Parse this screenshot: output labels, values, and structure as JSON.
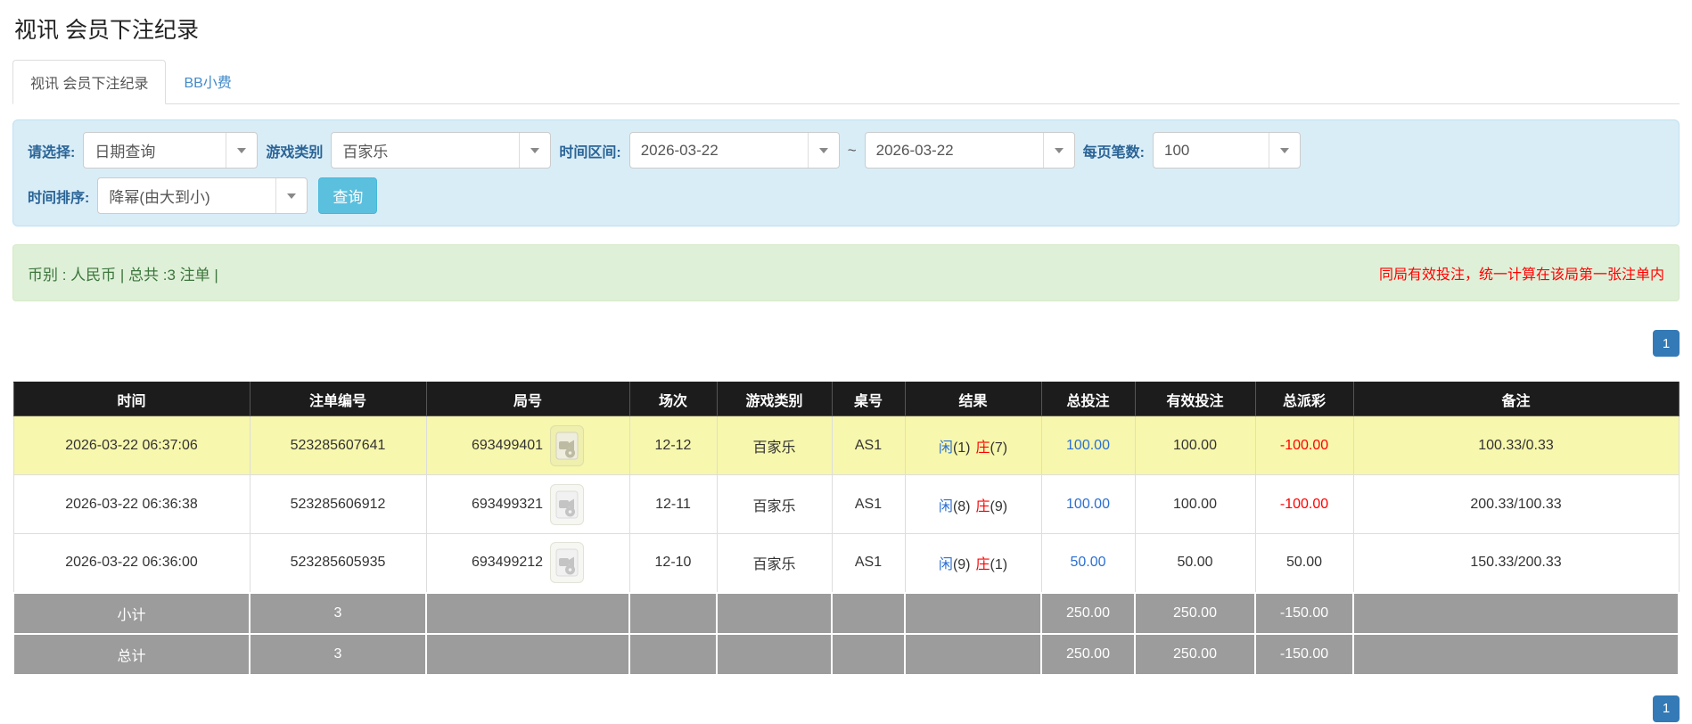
{
  "page_title": "视讯 会员下注纪录",
  "tabs": {
    "active": "视讯 会员下注纪录",
    "bb_tip": "BB小费"
  },
  "filters": {
    "query_type": {
      "label": "请选择:",
      "value": "日期查询"
    },
    "game_type": {
      "label": "游戏类别",
      "value": "百家乐"
    },
    "time_range": {
      "label": "时间区间:",
      "from": "2026-03-22",
      "separator": "~",
      "to": "2026-03-22"
    },
    "page_size": {
      "label": "每页笔数:",
      "value": "100"
    },
    "time_sort": {
      "label": "时间排序:",
      "value": "降幂(由大到小)"
    },
    "search_button": "查询"
  },
  "summary_bar": {
    "left": "币别 : 人民币 | 总共 :3 注单 |",
    "right": "同局有效投注，统一计算在该局第一张注单内"
  },
  "pagination": {
    "page": "1"
  },
  "table": {
    "headers": {
      "time": "时间",
      "bet_id": "注单编号",
      "round_id": "局号",
      "session": "场次",
      "game_type": "游戏类别",
      "table_no": "桌号",
      "result": "结果",
      "total_bet": "总投注",
      "valid_bet": "有效投注",
      "payout": "总派彩",
      "note": "备注"
    },
    "rows": [
      {
        "time": "2026-03-22 06:37:06",
        "bet_id": "523285607641",
        "round_id": "693499401",
        "session": "12-12",
        "game_type": "百家乐",
        "table_no": "AS1",
        "result": {
          "player_label": "闲",
          "player_count": "(1)",
          "banker_label": "庄",
          "banker_count": "(7)"
        },
        "total_bet": "100.00",
        "valid_bet": "100.00",
        "payout": "-100.00",
        "note": "100.33/0.33"
      },
      {
        "time": "2026-03-22 06:36:38",
        "bet_id": "523285606912",
        "round_id": "693499321",
        "session": "12-11",
        "game_type": "百家乐",
        "table_no": "AS1",
        "result": {
          "player_label": "闲",
          "player_count": "(8)",
          "banker_label": "庄",
          "banker_count": "(9)"
        },
        "total_bet": "100.00",
        "valid_bet": "100.00",
        "payout": "-100.00",
        "note": "200.33/100.33"
      },
      {
        "time": "2026-03-22 06:36:00",
        "bet_id": "523285605935",
        "round_id": "693499212",
        "session": "12-10",
        "game_type": "百家乐",
        "table_no": "AS1",
        "result": {
          "player_label": "闲",
          "player_count": "(9)",
          "banker_label": "庄",
          "banker_count": "(1)"
        },
        "total_bet": "50.00",
        "valid_bet": "50.00",
        "payout": "50.00",
        "note": "150.33/200.33"
      }
    ],
    "summary": [
      {
        "label": "小计",
        "count": "3",
        "total_bet": "250.00",
        "valid_bet": "250.00",
        "payout": "-150.00"
      },
      {
        "label": "总计",
        "count": "3",
        "total_bet": "250.00",
        "valid_bet": "250.00",
        "payout": "-150.00"
      }
    ]
  },
  "colors": {
    "accent_blue": "#337ab7",
    "link_blue": "#2b6fd4",
    "negative_red": "#ff0000",
    "panel_blue": "#d9edf7",
    "green_bg": "#dff0d8",
    "green_text": "#3c763d",
    "header_bg": "#1c1c1c",
    "highlight_yellow": "#f7f7ad",
    "summary_gray": "#9c9c9c",
    "search_button_teal": "#5bc0de"
  }
}
